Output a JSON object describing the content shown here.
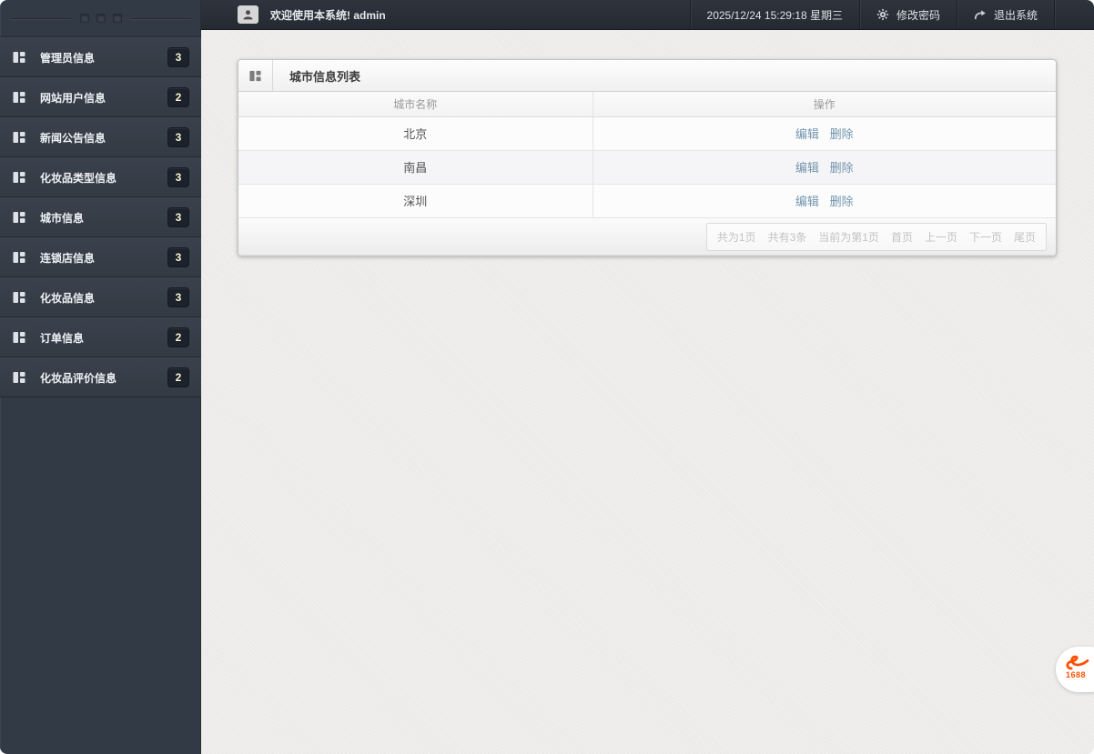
{
  "sidebar": {
    "items": [
      {
        "label": "管理员信息",
        "count": "3"
      },
      {
        "label": "网站用户信息",
        "count": "2"
      },
      {
        "label": "新闻公告信息",
        "count": "3"
      },
      {
        "label": "化妆品类型信息",
        "count": "3"
      },
      {
        "label": "城市信息",
        "count": "3"
      },
      {
        "label": "连锁店信息",
        "count": "3"
      },
      {
        "label": "化妆品信息",
        "count": "3"
      },
      {
        "label": "订单信息",
        "count": "2"
      },
      {
        "label": "化妆品评价信息",
        "count": "2"
      }
    ]
  },
  "header": {
    "welcome": "欢迎使用本系统! admin",
    "datetime": "2025/12/24 15:29:18 星期三",
    "change_password": "修改密码",
    "logout": "退出系统"
  },
  "panel": {
    "title": "城市信息列表",
    "table": {
      "columns": [
        "城市名称",
        "操作"
      ],
      "rows": [
        {
          "city": "北京",
          "edit": "编辑",
          "delete": "删除"
        },
        {
          "city": "南昌",
          "edit": "编辑",
          "delete": "删除"
        },
        {
          "city": "深圳",
          "edit": "编辑",
          "delete": "删除"
        }
      ]
    },
    "pagination": {
      "summary": [
        "共为1页",
        "共有3条",
        "当前为第1页"
      ],
      "links": [
        "首页",
        "上一页",
        "下一页",
        "尾页"
      ]
    }
  },
  "logo": {
    "text": "1688"
  },
  "icons": {
    "menu_item": "grid-icon",
    "panel_title": "grid-icon",
    "welcome": "user-icon",
    "change_password": "gear-icon",
    "logout": "logout-arrow-icon",
    "bottom_right": "1688-logo"
  },
  "colors": {
    "sidebar_bg": "#323a45",
    "topbar_bg": "#2a3039",
    "badge_bg": "#1c222c",
    "badge_text": "#f8f2cf",
    "link": "#7295ae",
    "logo_orange": "#ff5000",
    "main_bg": "#edeceb"
  }
}
